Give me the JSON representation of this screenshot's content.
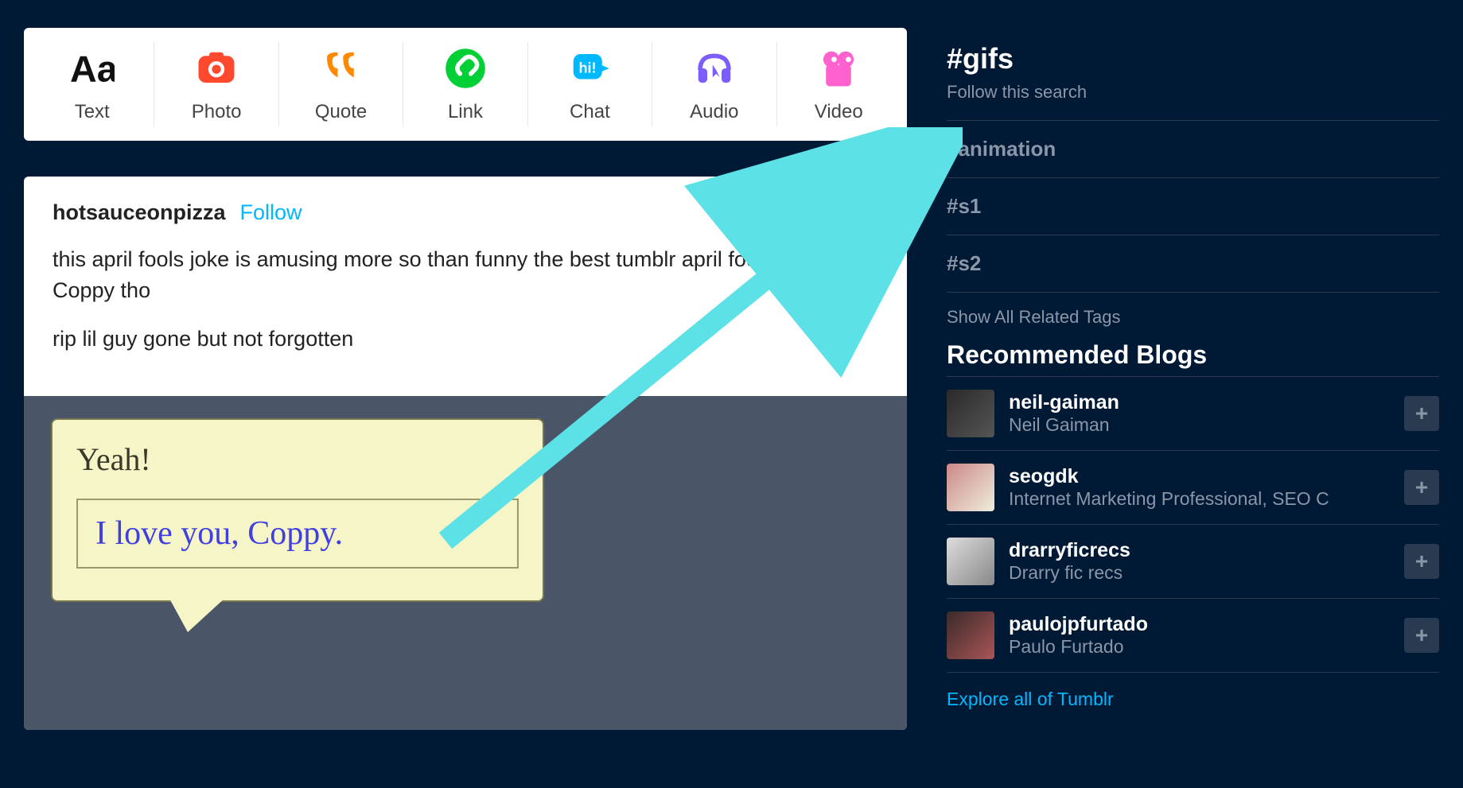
{
  "compose": {
    "items": [
      {
        "label": "Text",
        "icon": "text-icon"
      },
      {
        "label": "Photo",
        "icon": "photo-icon"
      },
      {
        "label": "Quote",
        "icon": "quote-icon"
      },
      {
        "label": "Link",
        "icon": "link-icon"
      },
      {
        "label": "Chat",
        "icon": "chat-icon"
      },
      {
        "label": "Audio",
        "icon": "audio-icon"
      },
      {
        "label": "Video",
        "icon": "video-icon"
      }
    ]
  },
  "post": {
    "author": "hotsauceonpizza",
    "follow_label": "Follow",
    "body": [
      "this april fools joke is amusing more so than funny the best tumblr april fools is still Coppy tho",
      "rip lil guy gone but not forgotten"
    ],
    "bubble": {
      "title": "Yeah!",
      "text": "I love you, Coppy."
    }
  },
  "sidebar": {
    "current_tag": "#gifs",
    "follow_search_label": "Follow this search",
    "related_tags": [
      "#animation",
      "#s1",
      "#s2"
    ],
    "show_all_label": "Show All Related Tags",
    "recommended_title": "Recommended Blogs",
    "blogs": [
      {
        "name": "neil-gaiman",
        "desc": "Neil Gaiman"
      },
      {
        "name": "seogdk",
        "desc": "Internet Marketing Professional, SEO C"
      },
      {
        "name": "drarryficrecs",
        "desc": "Drarry fic recs"
      },
      {
        "name": "paulojpfurtado",
        "desc": "Paulo Furtado"
      }
    ],
    "explore_label": "Explore all of Tumblr"
  },
  "icons": {
    "plus": "+"
  },
  "colors": {
    "background": "#001935",
    "accent": "#00b8ff",
    "arrow": "#5ce1e6"
  }
}
